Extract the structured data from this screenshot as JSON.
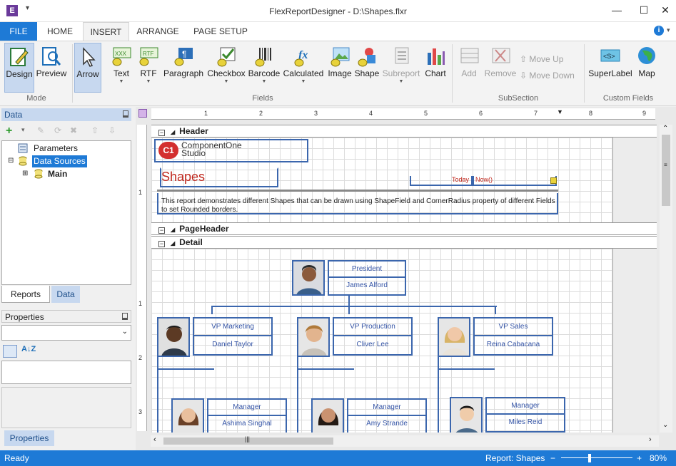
{
  "window": {
    "title": "FlexReportDesigner - D:\\Shapes.flxr",
    "app_icon": "E"
  },
  "tabs": [
    {
      "label": "FILE"
    },
    {
      "label": "HOME"
    },
    {
      "label": "INSERT"
    },
    {
      "label": "ARRANGE"
    },
    {
      "label": "PAGE SETUP"
    }
  ],
  "ribbon": {
    "mode": {
      "design": "Design",
      "preview": "Preview",
      "group": "Mode"
    },
    "fields": {
      "arrow": "Arrow",
      "text": "Text",
      "rtf": "RTF",
      "paragraph": "Paragraph",
      "checkbox": "Checkbox",
      "barcode": "Barcode",
      "calculated": "Calculated",
      "image": "Image",
      "shape": "Shape",
      "subreport": "Subreport",
      "chart": "Chart",
      "group": "Fields",
      "text_icon_text": "XXX",
      "rtf_icon_text": "RTF",
      "calc_icon_text": "fx"
    },
    "subsection": {
      "add": "Add",
      "remove": "Remove",
      "move_up": "Move Up",
      "move_down": "Move Down",
      "group": "SubSection"
    },
    "custom": {
      "superlabel": "SuperLabel",
      "map": "Map",
      "group": "Custom Fields",
      "superlabel_icon_text": "<S>"
    }
  },
  "left_panel": {
    "data_title": "Data",
    "tree": {
      "parameters": "Parameters",
      "data_sources": "Data Sources",
      "main": "Main"
    },
    "subtabs": {
      "reports": "Reports",
      "data": "Data"
    },
    "properties_title": "Properties",
    "properties_tab": "Properties"
  },
  "ruler": {
    "h": [
      "1",
      "2",
      "3",
      "4",
      "5",
      "6",
      "7",
      "8",
      "9"
    ],
    "v": [
      "1",
      "1",
      "2",
      "3"
    ]
  },
  "report": {
    "sections": {
      "header": "Header",
      "page_header": "PageHeader",
      "detail": "Detail"
    },
    "logo": {
      "line1": "ComponentOne",
      "line2": "Studio",
      "mark": "C1"
    },
    "title": "Shapes",
    "today_label": "Today",
    "now_expr": "Now()",
    "description": "This report demonstrates different Shapes that can be drawn using ShapeField and CornerRadius property of different Fields to set Rounded borders.",
    "org": [
      {
        "title": "President",
        "name": "James Alford"
      },
      {
        "title": "VP Marketing",
        "name": "Daniel Taylor"
      },
      {
        "title": "VP Production",
        "name": "Cliver Lee"
      },
      {
        "title": "VP Sales",
        "name": "Reina Cabacana"
      },
      {
        "title": "Manager",
        "name": "Ashima Singhal"
      },
      {
        "title": "Manager",
        "name": "Amy Strande"
      },
      {
        "title": "Manager",
        "name": "Miles Reid"
      }
    ]
  },
  "status": {
    "left": "Ready",
    "report": "Report: Shapes",
    "zoom": "80%",
    "zoom_level": 0.8
  },
  "colors": {
    "accent": "#1e7ad6",
    "title_red": "#c0281e",
    "field_blue": "#3454a6"
  }
}
